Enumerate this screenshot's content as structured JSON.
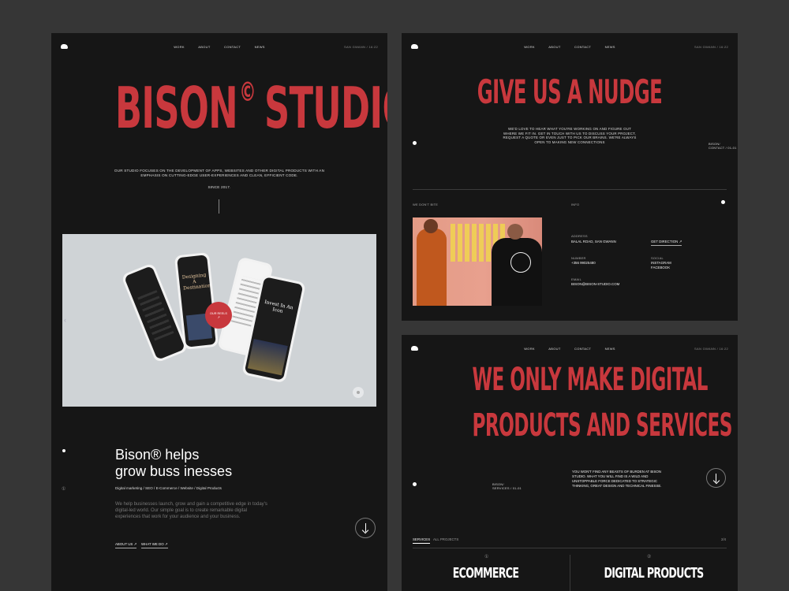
{
  "nav": {
    "links": [
      "WORK",
      "ABOUT",
      "CONTACT",
      "NEWS"
    ],
    "location": "SAN GWANN / 16:22"
  },
  "hero": {
    "title_left": "BISON",
    "copyright": "©",
    "title_right": "STUDIO",
    "description_line1": "OUR STUDIO FOCUSES ON THE DEVELOPMENT OF APPS, WEBSITES AND OTHER DIGITAL PRODUCTS WITH AN",
    "description_line2": "EMPHASIS ON CUTTING-EDGE USER-EXPERIENCES AND CLEAN, EFFICIENT CODE.",
    "since": "SINCE 2017."
  },
  "showcase": {
    "reel_label": "OUR REELS",
    "reel_arrow": "↗",
    "phone_text_1": "Designing A Destination",
    "phone_text_2": "Invest In An Icon"
  },
  "about": {
    "heading_line1": "Bison® helps",
    "heading_line2": "grow buss inesses",
    "services": "Digital marketing / SEO / E-Commerce / Website / Digital Products",
    "body": "We help businesses launch, grow and gain a competitive edge in today's digital-led world. Our simple goal is to create remarkable digital experiences that work for your audience and your business.",
    "link1": "ABOUT US",
    "link2": "WHAT WE DO",
    "side_number": "①"
  },
  "contact": {
    "title": "GIVE US A NUDGE",
    "text_lines": [
      "WE'D LOVE TO HEAR WHAT YOU'RE WORKING ON AND FIGURE OUT",
      "WHERE WE FIT IN. GET IN TOUCH WITH US TO DISCUSS YOUR PROJECT,",
      "REQUEST A QUOTE OR EVEN JUST TO PICK OUR BRAINS. WE'RE ALWAYS",
      "OPEN TO MAKING NEW CONNECTIONS"
    ],
    "side_label_1": "BISON/",
    "side_label_2": "CONTACT / 01-01",
    "left_tag": "WE DON'T BITE",
    "info_tag": "INFO",
    "address_tag": "ADDRESS",
    "address": "BALAL ROAD, SAN GWANN",
    "direction_link": "GET DIRECTION",
    "number_tag": "NUMBER",
    "number": "+356 99025480",
    "social_tag": "SOCIAL",
    "social_1": "INSTAGRAM",
    "social_2": "FACEBOOK",
    "email_tag": "EMAIL",
    "email": "BISON@BISON-STUDIO.COM"
  },
  "services": {
    "title_line1": "WE ONLY MAKE DIGITAL",
    "title_line2": "PRODUCTS AND SERVICES",
    "text_lines": [
      "YOU WON'T FIND ANY BEASTS OF BURDEN AT BISON",
      "STUDIO. WHAT YOU WILL FIND IS A WILD AND",
      "UNSTOPPABLE FORCE DEDICATED TO STRATEGIC",
      "THINKING, GREAT DESIGN AND TECHNICAL FINESSE."
    ],
    "side_label_1": "BISON/",
    "side_label_2": "SERVICES / 01-01",
    "tab_active": "SERVICES",
    "tab_other": "ALL PROJECTS",
    "count": "2/4",
    "item1_num": "①",
    "item1": "ECOMMERCE",
    "item2_num": "②",
    "item2": "DIGITAL PRODUCTS"
  },
  "colors": {
    "accent": "#c8383d",
    "panel": "#161616",
    "background": "#363636"
  }
}
